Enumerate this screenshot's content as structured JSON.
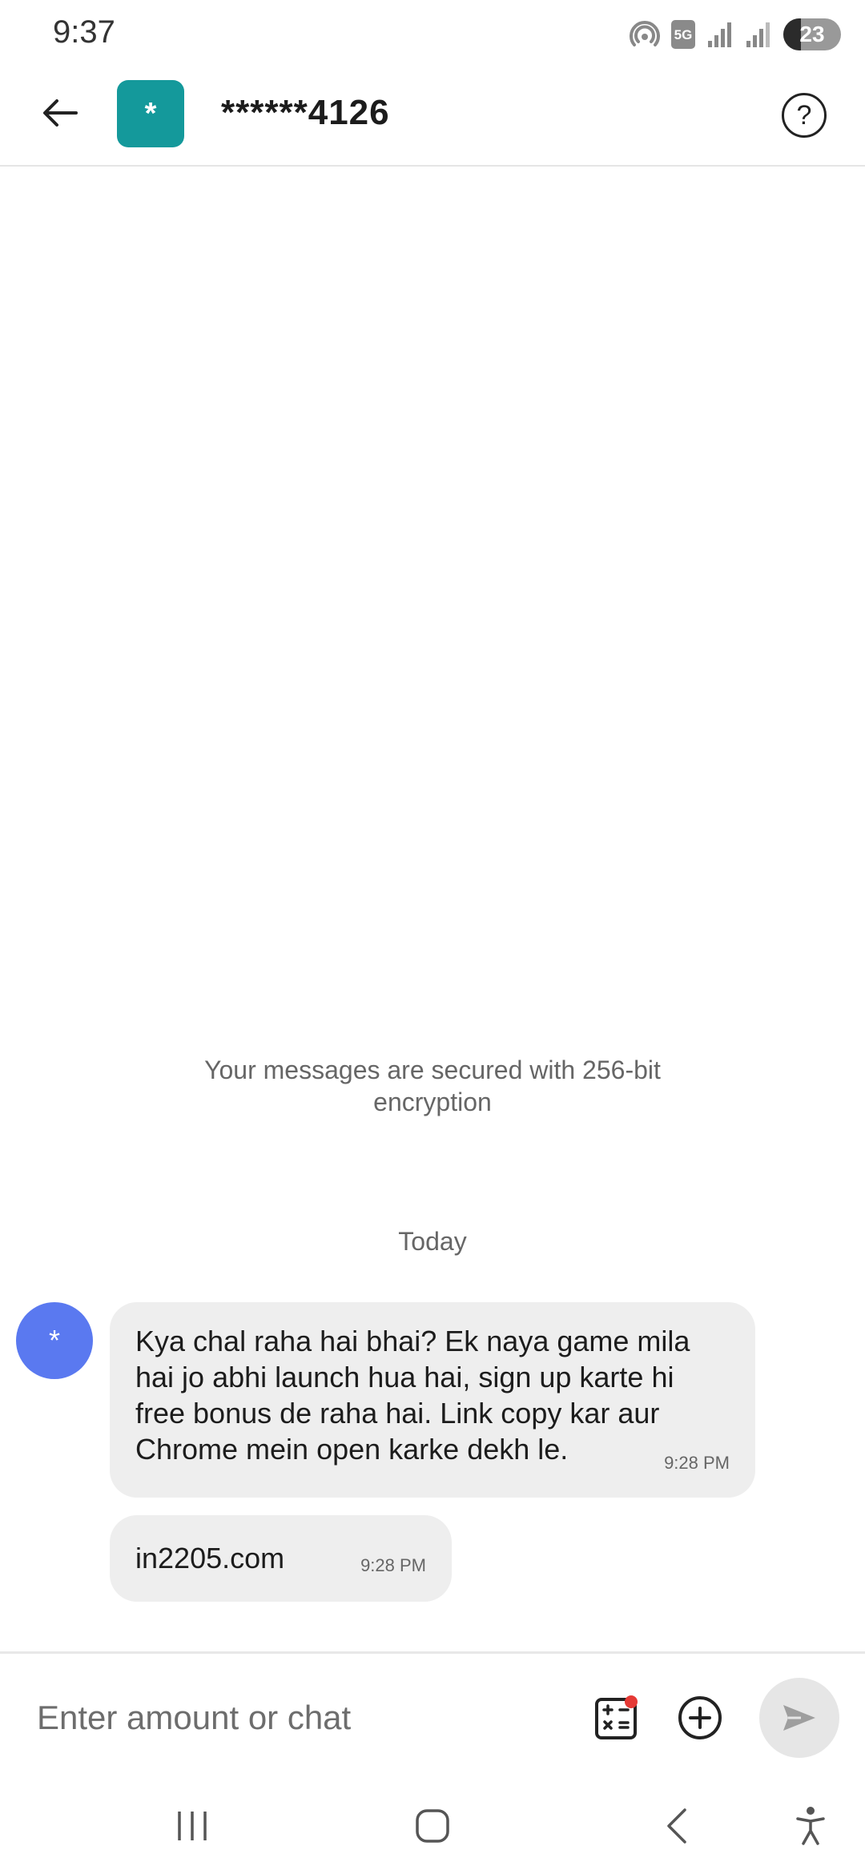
{
  "status_bar": {
    "time": "9:37",
    "network_badge": "5G",
    "battery": "23"
  },
  "header": {
    "avatar_initial": "*",
    "contact_name": "******4126",
    "help_glyph": "?"
  },
  "conversation": {
    "encryption_note": "Your messages are secured with 256-bit encryption",
    "date_separator": "Today",
    "sender_avatar": "*",
    "messages": [
      {
        "text": "Kya chal raha hai bhai? Ek naya game mila hai jo abhi launch hua hai, sign up karte hi free bonus de raha hai. Link copy kar aur Chrome mein open karke dekh le.",
        "time": "9:28 PM"
      },
      {
        "text": "in2205.com",
        "time": "9:28 PM"
      }
    ]
  },
  "composer": {
    "placeholder": "Enter amount or chat"
  },
  "colors": {
    "contact_avatar": "#14999b",
    "sender_avatar": "#5a79f0",
    "bubble": "#eeeeee",
    "notification_dot": "#e53935"
  }
}
